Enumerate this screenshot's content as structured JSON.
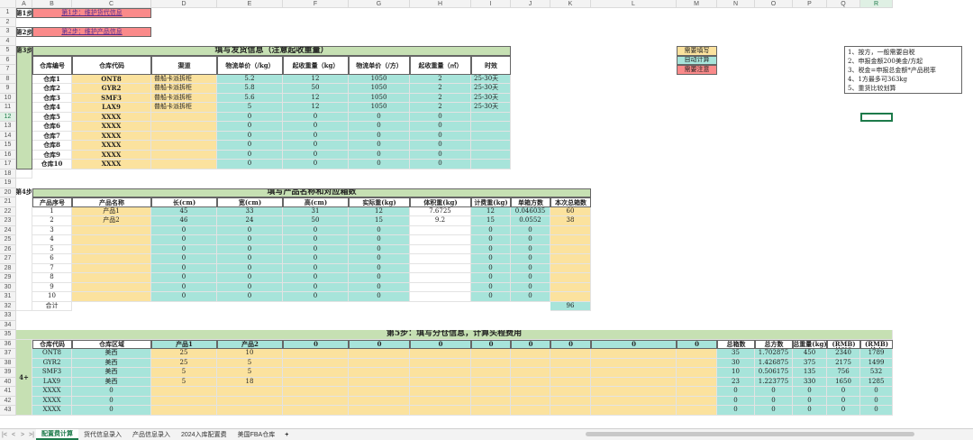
{
  "columns": [
    "A",
    "B",
    "C",
    "D",
    "E",
    "F",
    "G",
    "H",
    "I",
    "J",
    "K",
    "L",
    "M",
    "N",
    "O",
    "P",
    "Q",
    "R"
  ],
  "rows": [
    "1",
    "2",
    "3",
    "4",
    "5",
    "6",
    "7",
    "8",
    "9",
    "10",
    "11",
    "12",
    "13",
    "14",
    "15",
    "16",
    "17",
    "18",
    "19",
    "20",
    "21",
    "22",
    "23",
    "24",
    "25",
    "26",
    "27",
    "28",
    "29",
    "30",
    "31",
    "32",
    "33",
    "34",
    "35",
    "36",
    "37",
    "38",
    "39",
    "40",
    "41",
    "42",
    "43"
  ],
  "steps": {
    "s1": "第1步",
    "s2": "第2步",
    "s3": "第3步",
    "s4": "第4步",
    "s5": "4+"
  },
  "links": {
    "l1": "第1步：维护货代信息",
    "l2": "第2步：维护产品信息"
  },
  "legend": {
    "fill": "需要填写",
    "auto": "自动计算",
    "note": "需要注意"
  },
  "notes": [
    "1、按方，一般需要自税",
    "2、申报金额200美金/方起",
    "3、税金=申报总金额*产品税率",
    "4、1方最多可363kg",
    "5、重货比较划算"
  ],
  "section3": {
    "title": "填写发货信息（注意起收重量）",
    "headers": [
      "仓库编号",
      "仓库代码",
      "渠道",
      "物流单价（/kg）",
      "起收重量（kg）",
      "物流单价（/方）",
      "起收重量（㎡）",
      "时效"
    ],
    "rows": [
      [
        "仓库1",
        "ONT8",
        "普船卡派拆柜",
        "5.2",
        "12",
        "1050",
        "2",
        "25-30天"
      ],
      [
        "仓库2",
        "GYR2",
        "普船卡派拆柜",
        "5.8",
        "50",
        "1050",
        "2",
        "25-30天"
      ],
      [
        "仓库3",
        "SMF3",
        "普船卡派拆柜",
        "5.6",
        "12",
        "1050",
        "2",
        "25-30天"
      ],
      [
        "仓库4",
        "LAX9",
        "普船卡派拆柜",
        "5",
        "12",
        "1050",
        "2",
        "25-30天"
      ],
      [
        "仓库5",
        "XXXX",
        "",
        "0",
        "0",
        "0",
        "0",
        ""
      ],
      [
        "仓库6",
        "XXXX",
        "",
        "0",
        "0",
        "0",
        "0",
        ""
      ],
      [
        "仓库7",
        "XXXX",
        "",
        "0",
        "0",
        "0",
        "0",
        ""
      ],
      [
        "仓库8",
        "XXXX",
        "",
        "0",
        "0",
        "0",
        "0",
        ""
      ],
      [
        "仓库9",
        "XXXX",
        "",
        "0",
        "0",
        "0",
        "0",
        ""
      ],
      [
        "仓库10",
        "XXXX",
        "",
        "0",
        "0",
        "0",
        "0",
        ""
      ]
    ]
  },
  "section4": {
    "title": "填写产品名称和对应箱数",
    "headers": [
      "产品序号",
      "产品名称",
      "长(cm)",
      "宽(cm)",
      "高(cm)",
      "实际重(kg)",
      "体积重(kg)",
      "计费重(kg)",
      "单箱方数",
      "本次总箱数"
    ],
    "rows": [
      [
        "1",
        "产品1",
        "45",
        "33",
        "31",
        "12",
        "7.6725",
        "12",
        "0.046035",
        "60"
      ],
      [
        "2",
        "产品2",
        "46",
        "24",
        "50",
        "15",
        "9.2",
        "15",
        "0.0552",
        "38"
      ],
      [
        "3",
        "",
        "0",
        "0",
        "0",
        "0",
        "",
        "0",
        "0",
        ""
      ],
      [
        "4",
        "",
        "0",
        "0",
        "0",
        "0",
        "",
        "0",
        "0",
        ""
      ],
      [
        "5",
        "",
        "0",
        "0",
        "0",
        "0",
        "",
        "0",
        "0",
        ""
      ],
      [
        "6",
        "",
        "0",
        "0",
        "0",
        "0",
        "",
        "0",
        "0",
        ""
      ],
      [
        "7",
        "",
        "0",
        "0",
        "0",
        "0",
        "",
        "0",
        "0",
        ""
      ],
      [
        "8",
        "",
        "0",
        "0",
        "0",
        "0",
        "",
        "0",
        "0",
        ""
      ],
      [
        "9",
        "",
        "0",
        "0",
        "0",
        "0",
        "",
        "0",
        "0",
        ""
      ],
      [
        "10",
        "",
        "0",
        "0",
        "0",
        "0",
        "",
        "0",
        "0",
        ""
      ]
    ],
    "total_label": "合计",
    "total": "96"
  },
  "section5": {
    "title": "第5步：填写分仓信息，计算头程费用",
    "headers": [
      "仓库代码",
      "仓库区域",
      "产品1",
      "产品2",
      "0",
      "0",
      "0",
      "0",
      "0",
      "0",
      "0",
      "0",
      "总箱数",
      "总方数",
      "总重量(kg)",
      "收费(RMB) 按KG",
      "收费(RMB) 按方"
    ],
    "rows": [
      [
        "ONT8",
        "美西",
        "25",
        "10",
        "",
        "",
        "",
        "",
        "",
        "",
        "",
        "",
        "35",
        "1.702875",
        "450",
        "2340",
        "1789"
      ],
      [
        "GYR2",
        "美西",
        "25",
        "5",
        "",
        "",
        "",
        "",
        "",
        "",
        "",
        "",
        "30",
        "1.426875",
        "375",
        "2175",
        "1499"
      ],
      [
        "SMF3",
        "美西",
        "5",
        "5",
        "",
        "",
        "",
        "",
        "",
        "",
        "",
        "",
        "10",
        "0.506175",
        "135",
        "756",
        "532"
      ],
      [
        "LAX9",
        "美西",
        "5",
        "18",
        "",
        "",
        "",
        "",
        "",
        "",
        "",
        "",
        "23",
        "1.223775",
        "330",
        "1650",
        "1285"
      ],
      [
        "XXXX",
        "0",
        "",
        "",
        "",
        "",
        "",
        "",
        "",
        "",
        "",
        "",
        "0",
        "0",
        "0",
        "0",
        "0"
      ],
      [
        "XXXX",
        "0",
        "",
        "",
        "",
        "",
        "",
        "",
        "",
        "",
        "",
        "",
        "0",
        "0",
        "0",
        "0",
        "0"
      ],
      [
        "XXXX",
        "0",
        "",
        "",
        "",
        "",
        "",
        "",
        "",
        "",
        "",
        "",
        "0",
        "0",
        "0",
        "0",
        "0"
      ]
    ]
  },
  "tabs": {
    "t1": "配置费计算",
    "t2": "货代信息录入",
    "t3": "产品信息录入",
    "t4": "2024入库配置费",
    "t5": "美国FBA仓库",
    "add": "+"
  },
  "nav": {
    "first": "|<",
    "prev": "<",
    "next": ">",
    "last": ">|"
  },
  "colors": {
    "yellow": "#fbe29e",
    "teal": "#a7e4da",
    "green": "#c6e0b3",
    "red": "#fa8a8a",
    "accent": "#1d7a4a"
  }
}
